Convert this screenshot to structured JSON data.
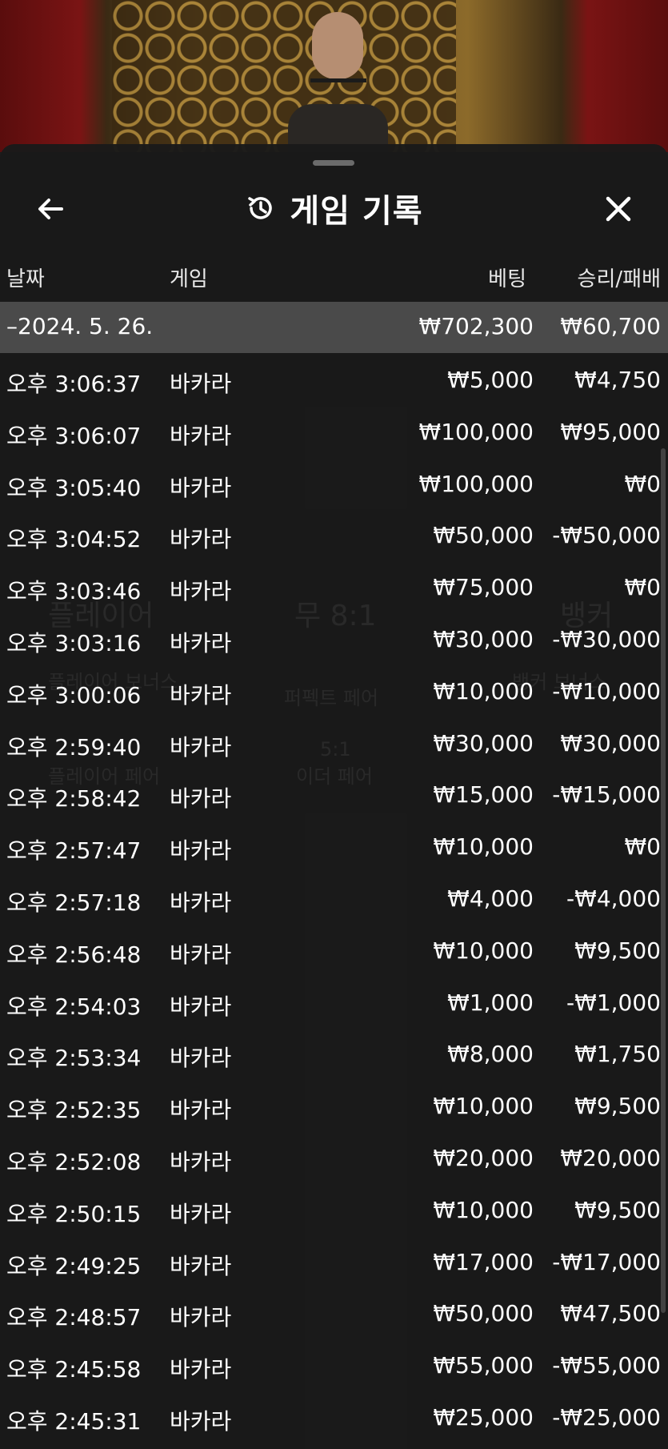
{
  "header": {
    "title": "게임 기록",
    "back_icon": "arrow-left-icon",
    "history_icon": "history-icon",
    "close_icon": "close-icon"
  },
  "columns": {
    "date": "날짜",
    "game": "게임",
    "bet": "베팅",
    "result": "승리/패배"
  },
  "date_group": {
    "date": "–2024. 5. 26.",
    "bet_total": "₩702,300",
    "result_total": "₩60,700"
  },
  "rows": [
    {
      "time": "오후 3:06:37",
      "game": "바카라",
      "bet": "₩5,000",
      "result": "₩4,750"
    },
    {
      "time": "오후 3:06:07",
      "game": "바카라",
      "bet": "₩100,000",
      "result": "₩95,000"
    },
    {
      "time": "오후 3:05:40",
      "game": "바카라",
      "bet": "₩100,000",
      "result": "₩0"
    },
    {
      "time": "오후 3:04:52",
      "game": "바카라",
      "bet": "₩50,000",
      "result": "-₩50,000"
    },
    {
      "time": "오후 3:03:46",
      "game": "바카라",
      "bet": "₩75,000",
      "result": "₩0"
    },
    {
      "time": "오후 3:03:16",
      "game": "바카라",
      "bet": "₩30,000",
      "result": "-₩30,000"
    },
    {
      "time": "오후 3:00:06",
      "game": "바카라",
      "bet": "₩10,000",
      "result": "-₩10,000"
    },
    {
      "time": "오후 2:59:40",
      "game": "바카라",
      "bet": "₩30,000",
      "result": "₩30,000"
    },
    {
      "time": "오후 2:58:42",
      "game": "바카라",
      "bet": "₩15,000",
      "result": "-₩15,000"
    },
    {
      "time": "오후 2:57:47",
      "game": "바카라",
      "bet": "₩10,000",
      "result": "₩0"
    },
    {
      "time": "오후 2:57:18",
      "game": "바카라",
      "bet": "₩4,000",
      "result": "-₩4,000"
    },
    {
      "time": "오후 2:56:48",
      "game": "바카라",
      "bet": "₩10,000",
      "result": "₩9,500"
    },
    {
      "time": "오후 2:54:03",
      "game": "바카라",
      "bet": "₩1,000",
      "result": "-₩1,000"
    },
    {
      "time": "오후 2:53:34",
      "game": "바카라",
      "bet": "₩8,000",
      "result": "₩1,750"
    },
    {
      "time": "오후 2:52:35",
      "game": "바카라",
      "bet": "₩10,000",
      "result": "₩9,500"
    },
    {
      "time": "오후 2:52:08",
      "game": "바카라",
      "bet": "₩20,000",
      "result": "₩20,000"
    },
    {
      "time": "오후 2:50:15",
      "game": "바카라",
      "bet": "₩10,000",
      "result": "₩9,500"
    },
    {
      "time": "오후 2:49:25",
      "game": "바카라",
      "bet": "₩17,000",
      "result": "-₩17,000"
    },
    {
      "time": "오후 2:48:57",
      "game": "바카라",
      "bet": "₩50,000",
      "result": "₩47,500"
    },
    {
      "time": "오후 2:45:58",
      "game": "바카라",
      "bet": "₩55,000",
      "result": "-₩55,000"
    },
    {
      "time": "오후 2:45:31",
      "game": "바카라",
      "bet": "₩25,000",
      "result": "-₩25,000"
    }
  ],
  "background_ghost": {
    "player": "플레이어",
    "tie": "무 8:1",
    "banker": "뱅커",
    "player_bonus": "플레이어 보너스",
    "perfect_pair": "퍼펙트 페어",
    "banker_bonus": "뱅커 보너스",
    "either_pair": "이더 페어",
    "player_pair": "플레이어 페어",
    "ratio": "5:1"
  }
}
